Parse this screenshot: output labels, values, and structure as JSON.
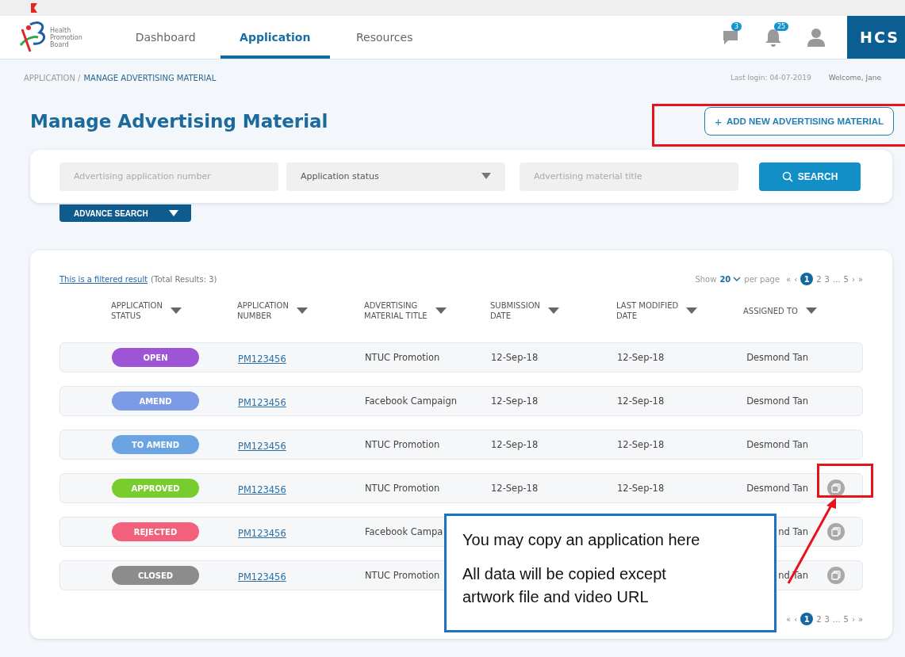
{
  "header": {
    "logo_text": [
      "Health",
      "Promotion",
      "Board"
    ],
    "nav": [
      {
        "label": "Dashboard",
        "selected": false
      },
      {
        "label": "Application",
        "selected": true
      },
      {
        "label": "Resources",
        "selected": false
      }
    ],
    "messages_badge": "3",
    "notifications_badge": "25",
    "app_name": "HCS"
  },
  "breadcrumb": {
    "parent": "APPLICATION /",
    "current": "MANAGE ADVERTISING MATERIAL"
  },
  "last_login": "Last login: 04-07-2019",
  "welcome": "Welcome, Jane",
  "page_title": "Manage Advertising Material",
  "add_button": {
    "icon": "+",
    "label": "ADD NEW ADVERTISING MATERIAL"
  },
  "search": {
    "number_placeholder": "Advertising application number",
    "status_value": "Application status",
    "title_placeholder": "Advertising material title",
    "button": "SEARCH",
    "advance": "ADVANCE SEARCH"
  },
  "results": {
    "filter_link": "This is a filtered result",
    "total": "(Total Results: 3)",
    "show": "Show",
    "per_page_value": "20",
    "per_page": "per page",
    "pages": [
      {
        "label": "«",
        "selected": false
      },
      {
        "label": "‹",
        "selected": false
      },
      {
        "label": "1",
        "selected": true
      },
      {
        "label": "2",
        "selected": false
      },
      {
        "label": "3",
        "selected": false
      },
      {
        "label": "...",
        "selected": false
      },
      {
        "label": "5",
        "selected": false
      },
      {
        "label": "›",
        "selected": false
      },
      {
        "label": "»",
        "selected": false
      }
    ],
    "bottom_pages": [
      {
        "label": "«",
        "selected": false
      },
      {
        "label": "‹",
        "selected": false
      },
      {
        "label": "1",
        "selected": true
      },
      {
        "label": "2",
        "selected": false
      },
      {
        "label": "3",
        "selected": false
      },
      {
        "label": "...",
        "selected": false
      },
      {
        "label": "5",
        "selected": false
      },
      {
        "label": "›",
        "selected": false
      },
      {
        "label": "»",
        "selected": false
      }
    ],
    "columns": [
      {
        "line1": "APPLICATION",
        "line2": "STATUS"
      },
      {
        "line1": "APPLICATION",
        "line2": "NUMBER"
      },
      {
        "line1": "ADVERTISING",
        "line2": "MATERIAL TITLE"
      },
      {
        "line1": "SUBMISSION",
        "line2": "DATE"
      },
      {
        "line1": "LAST MODIFIED",
        "line2": "DATE"
      },
      {
        "line1": "ASSIGNED TO"
      }
    ],
    "rows": [
      {
        "status": "OPEN",
        "color": "#9d55d6",
        "number": "PM123456",
        "title": "NTUC Promotion",
        "submitted": "12-Sep-18",
        "modified": "12-Sep-18",
        "assigned": "Desmond Tan",
        "copy_action": false
      },
      {
        "status": "AMEND",
        "color": "#7c9be6",
        "number": "PM123456",
        "title": "Facebook Campaign",
        "submitted": "12-Sep-18",
        "modified": "12-Sep-18",
        "assigned": "Desmond Tan",
        "copy_action": false
      },
      {
        "status": "TO AMEND",
        "color": "#6ba4e2",
        "number": "PM123456",
        "title": "NTUC Promotion",
        "submitted": "12-Sep-18",
        "modified": "12-Sep-18",
        "assigned": "Desmond Tan",
        "copy_action": false
      },
      {
        "status": "APPROVED",
        "color": "#79cc2e",
        "number": "PM123456",
        "title": "NTUC Promotion",
        "submitted": "12-Sep-18",
        "modified": "12-Sep-18",
        "assigned": "Desmond Tan",
        "copy_action": true
      },
      {
        "status": "REJECTED",
        "color": "#f2607c",
        "number": "PM123456",
        "title": "Facebook Campa",
        "assigned": "nd Tan",
        "copy_action": true
      },
      {
        "status": "CLOSED",
        "color": "#8c8c8c",
        "number": "PM123456",
        "title": "NTUC Promotion",
        "assigned": "nd Tan",
        "copy_action": true
      }
    ]
  },
  "callout": {
    "lines": [
      "You may copy an application here",
      "All data will be copied except artwork file and video URL"
    ]
  }
}
